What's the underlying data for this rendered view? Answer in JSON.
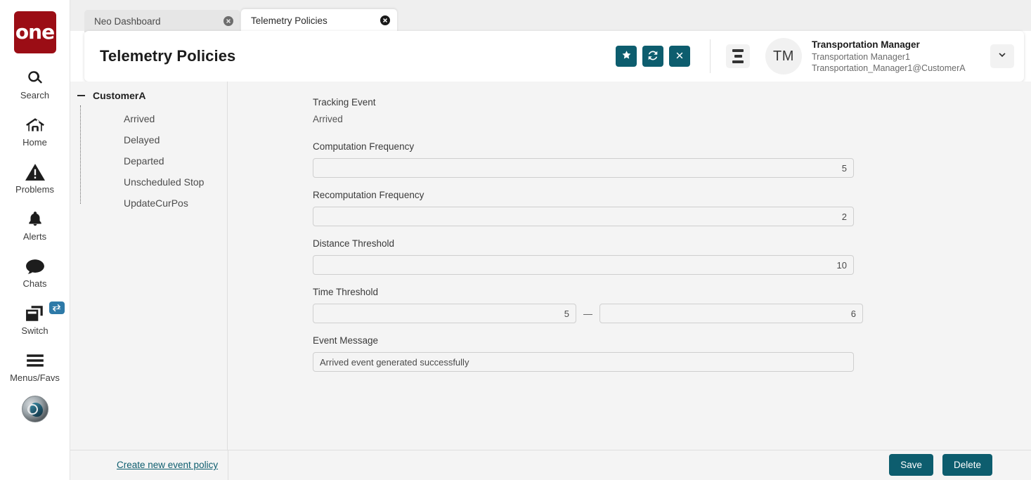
{
  "rail": {
    "logo_text": "one",
    "items": [
      {
        "label": "Search",
        "icon": "search-icon"
      },
      {
        "label": "Home",
        "icon": "home-icon"
      },
      {
        "label": "Problems",
        "icon": "warning-icon"
      },
      {
        "label": "Alerts",
        "icon": "bell-icon"
      },
      {
        "label": "Chats",
        "icon": "chat-icon"
      },
      {
        "label": "Switch",
        "icon": "windows-icon",
        "badge_icon": "swap-arrows-icon"
      },
      {
        "label": "Menus/Favs",
        "icon": "hamburger-icon"
      }
    ],
    "avatar_icon": "user-photo-icon"
  },
  "tabs": [
    {
      "label": "Neo Dashboard",
      "active": false,
      "close_icon": "close-circle-icon"
    },
    {
      "label": "Telemetry Policies",
      "active": true,
      "close_icon": "close-circle-icon"
    }
  ],
  "header": {
    "title": "Telemetry Policies",
    "actions": [
      {
        "name": "favorite-button",
        "icon": "star-icon"
      },
      {
        "name": "refresh-button",
        "icon": "refresh-icon"
      },
      {
        "name": "close-button",
        "icon": "x-icon"
      }
    ],
    "menu_icon": "list-menu-icon",
    "avatar_initials": "TM",
    "user_role": "Transportation Manager",
    "user_name": "Transportation Manager1",
    "user_email": "Transportation_Manager1@CustomerA",
    "chevron_icon": "chevron-down-icon"
  },
  "tree": {
    "root_label": "CustomerA",
    "toggle_icon": "minus-icon",
    "children": [
      "Arrived",
      "Delayed",
      "Departed",
      "Unscheduled Stop",
      "UpdateCurPos"
    ]
  },
  "form": {
    "tracking_event_label": "Tracking Event",
    "tracking_event_value": "Arrived",
    "computation_frequency_label": "Computation Frequency",
    "computation_frequency_value": "5",
    "recomputation_frequency_label": "Recomputation Frequency",
    "recomputation_frequency_value": "2",
    "distance_threshold_label": "Distance Threshold",
    "distance_threshold_value": "10",
    "time_threshold_label": "Time Threshold",
    "time_threshold_from": "5",
    "time_threshold_to": "6",
    "range_separator": "—",
    "event_message_label": "Event Message",
    "event_message_value": "Arrived event generated successfully"
  },
  "footer": {
    "create_link": "Create new event policy",
    "save_label": "Save",
    "delete_label": "Delete"
  },
  "colors": {
    "accent_teal": "#0d5d6e",
    "logo_red": "#9b0d15",
    "badge_blue": "#2e7aa8",
    "content_bg": "#f4f4f4"
  }
}
